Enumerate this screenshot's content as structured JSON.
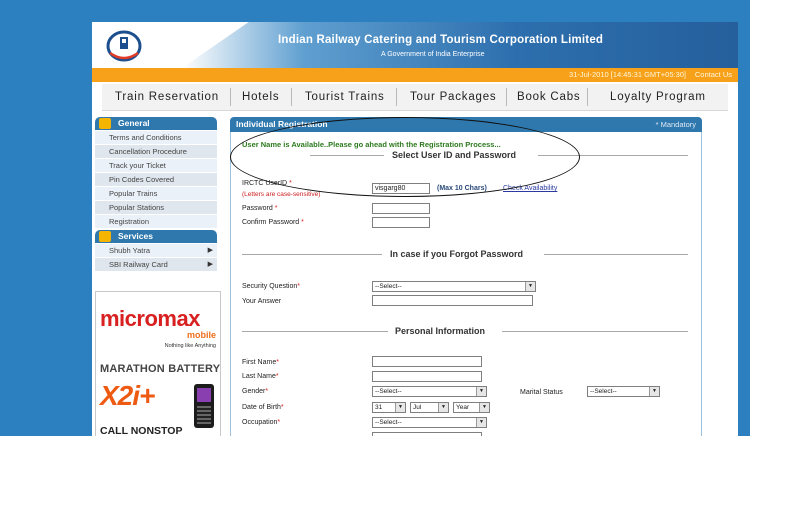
{
  "header": {
    "title": "Indian Railway Catering and Tourism Corporation Limited",
    "subtitle": "A Government of India Enterprise",
    "datetime": "31-Jul-2010 [14:45:31 GMT+05:30]",
    "contact": "Contact Us"
  },
  "nav": {
    "items": [
      "Train Reservation",
      "Hotels",
      "Tourist Trains",
      "Tour Packages",
      "Book Cabs",
      "Loyalty Program"
    ]
  },
  "sidebar": {
    "general_title": "General",
    "general_items": [
      "Terms and Conditions",
      "Cancellation Procedure",
      "Track your Ticket",
      "Pin Codes Covered",
      "Popular Trains",
      "Popular Stations",
      "Registration"
    ],
    "services_title": "Services",
    "services_items": [
      "Shubh Yatra",
      "SBI Railway Card"
    ]
  },
  "ad": {
    "brand": "micromax",
    "mobile": "mobile",
    "tagline": "Nothing like Anything",
    "headline": "MARATHON BATTERY",
    "model": "X2i+",
    "call": "CALL NONSTOP"
  },
  "form": {
    "panel_title": "Individual Registration",
    "mandatory_note": "* Mandatory",
    "availability_msg": "User Name is Available..Please go ahead with the Registration Process...",
    "section_userid": "Select User ID and Password",
    "userid_label": "IRCTC UserID",
    "userid_hint": "(Letters are case-sensitive)",
    "userid_value": "visgarg80",
    "max_chars": "(Max 10 Chars)",
    "check_availability": "Check Availability",
    "password_label": "Password",
    "confirm_password_label": "Confirm Password",
    "section_forgot": "In case if you Forgot Password",
    "security_question_label": "Security Question",
    "security_question_value": "--Select--",
    "your_answer_label": "Your Answer",
    "section_personal": "Personal Information",
    "first_name_label": "First Name",
    "last_name_label": "Last Name",
    "gender_label": "Gender",
    "gender_value": "--Select--",
    "marital_label": "Marital Status",
    "marital_value": "--Select--",
    "dob_label": "Date of Birth",
    "dob_day": "31",
    "dob_month": "Jul",
    "dob_year": "Year",
    "occupation_label": "Occupation",
    "occupation_value": "--Select--",
    "required_mark": "*"
  }
}
